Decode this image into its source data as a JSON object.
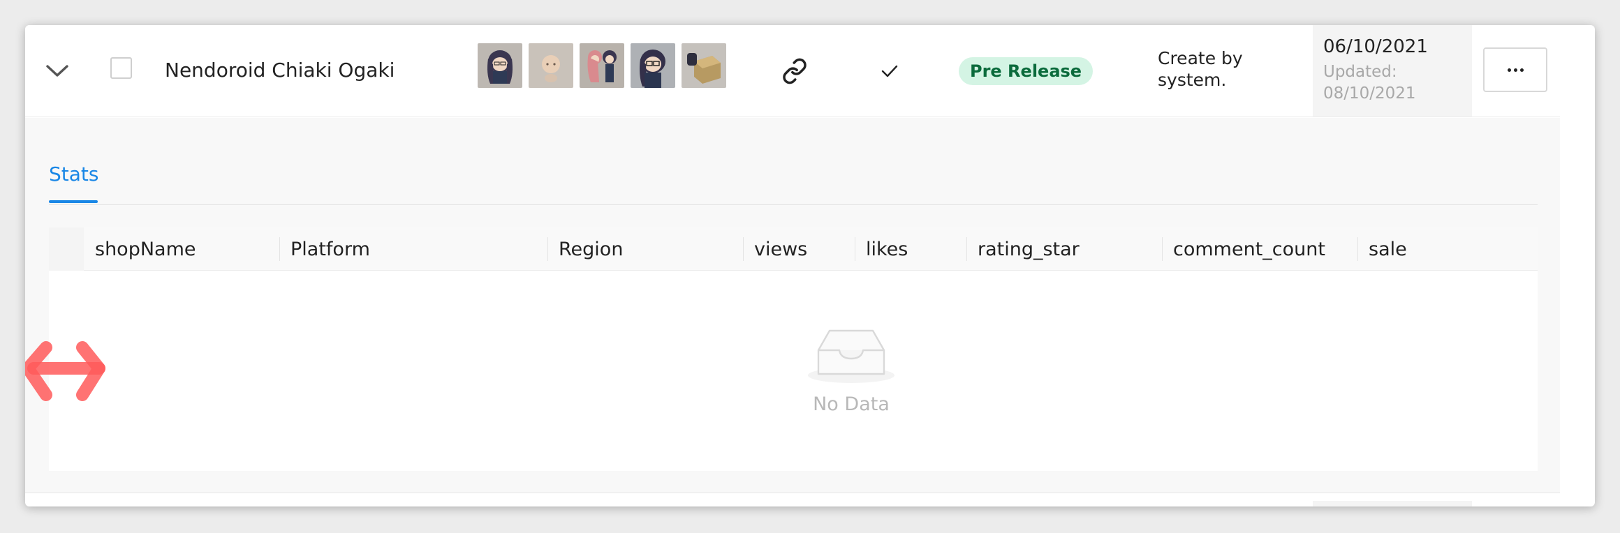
{
  "product_row": {
    "name": "Nendoroid Chiaki Ogaki",
    "thumbnails": [
      {
        "icon": "figure-front-thumbnail"
      },
      {
        "icon": "figure-face-thumbnail"
      },
      {
        "icon": "figure-pair-thumbnail"
      },
      {
        "icon": "figure-glasses-thumbnail"
      },
      {
        "icon": "figure-box-thumbnail"
      }
    ],
    "status_badge": "Pre Release",
    "status_colors": {
      "background": "#d4f4e4",
      "text": "#0b6b3c"
    },
    "created_by": "Create by system.",
    "date": "06/10/2021",
    "updated_label": "Updated:",
    "updated_date": "08/10/2021",
    "more_icon": "ellipsis-icon"
  },
  "stats_panel": {
    "tab_label": "Stats",
    "accent_color": "#1a87e6",
    "columns": [
      "shopName",
      "Platform",
      "Region",
      "views",
      "likes",
      "rating_star",
      "comment_count",
      "sale"
    ],
    "empty_text": "No Data",
    "empty_icon": "inbox-icon"
  },
  "overlay": {
    "icon": "horizontal-resize-arrow-icon",
    "color": "#ff5a5a"
  }
}
